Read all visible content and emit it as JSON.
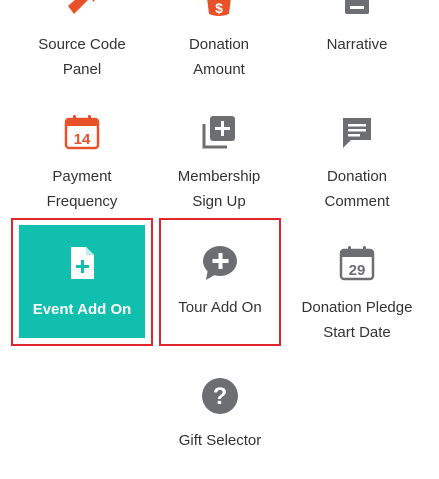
{
  "palette": {
    "accent": "#10bfae",
    "selection_border": "#e0262b",
    "orange": "#e8522a",
    "gray_icon": "#6d6e71"
  },
  "tiles": [
    {
      "id": "source-code-panel",
      "line1": "Source Code",
      "line2": "Panel",
      "icon": "arrow-icon"
    },
    {
      "id": "donation-amount",
      "line1": "Donation",
      "line2": "Amount",
      "icon": "dollar-tag-icon"
    },
    {
      "id": "narrative",
      "line1": "Narrative",
      "line2": "",
      "icon": "document-icon"
    },
    {
      "id": "payment-frequency",
      "line1": "Payment",
      "line2": "Frequency",
      "icon": "calendar-14-icon",
      "icon_text": "14"
    },
    {
      "id": "membership-sign-up",
      "line1": "Membership",
      "line2": "Sign Up",
      "icon": "add-stack-icon"
    },
    {
      "id": "donation-comment",
      "line1": "Donation",
      "line2": "Comment",
      "icon": "comment-icon"
    },
    {
      "id": "event-add-on",
      "line1": "Event Add On",
      "line2": "",
      "icon": "file-plus-icon",
      "selected": true,
      "active": true
    },
    {
      "id": "tour-add-on",
      "line1": "Tour Add On",
      "line2": "",
      "icon": "chat-plus-icon",
      "selected": true
    },
    {
      "id": "donation-pledge-start-date",
      "line1": "Donation Pledge",
      "line2": "Start Date",
      "icon": "calendar-29-icon",
      "icon_text": "29"
    },
    {
      "id": "gift-selector",
      "line1": "Gift Selector",
      "line2": "",
      "icon": "question-circle-icon",
      "icon_text": "?"
    }
  ]
}
